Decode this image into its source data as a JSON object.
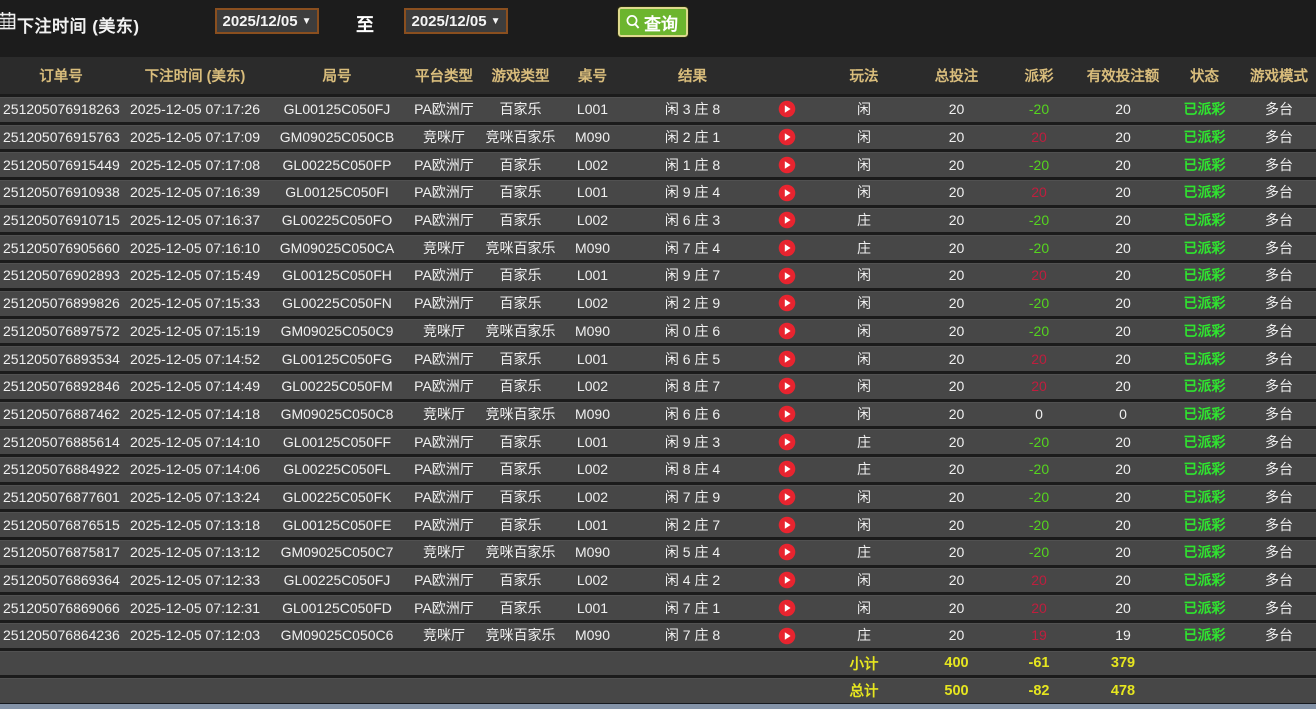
{
  "toolbar": {
    "label": "下注时间 (美东)",
    "date_from": "2025/12/05",
    "date_to": "2025/12/05",
    "to_label": "至",
    "search_label": "查询"
  },
  "colors": {
    "header_text": "#d9bd7c",
    "gain": "#bf1e3e",
    "loss": "#55d41f",
    "status_paid": "#2fe42f",
    "summary": "#e6e61f",
    "button_green": "#6cb52e"
  },
  "table": {
    "columns": [
      "订单号",
      "下注时间 (美东)",
      "局号",
      "平台类型",
      "游戏类型",
      "桌号",
      "结果",
      "",
      "玩法",
      "总投注",
      "派彩",
      "有效投注额",
      "状态",
      "游戏模式"
    ],
    "rows": [
      {
        "order": "251205076918263",
        "time": "2025-12-05 07:17:26",
        "round": "GL00125C050FJ",
        "platform": "PA欧洲厅",
        "game": "百家乐",
        "table_no": "L001",
        "result": "闲 3 庄 8",
        "play": "闲",
        "bet": "20",
        "payout": "-20",
        "payout_tone": "loss",
        "valid": "20",
        "status": "已派彩",
        "mode": "多台"
      },
      {
        "order": "251205076915763",
        "time": "2025-12-05 07:17:09",
        "round": "GM09025C050CB",
        "platform": "竞咪厅",
        "game": "竞咪百家乐",
        "table_no": "M090",
        "result": "闲 2 庄 1",
        "play": "闲",
        "bet": "20",
        "payout": "20",
        "payout_tone": "gain",
        "valid": "20",
        "status": "已派彩",
        "mode": "多台"
      },
      {
        "order": "251205076915449",
        "time": "2025-12-05 07:17:08",
        "round": "GL00225C050FP",
        "platform": "PA欧洲厅",
        "game": "百家乐",
        "table_no": "L002",
        "result": "闲 1 庄 8",
        "play": "闲",
        "bet": "20",
        "payout": "-20",
        "payout_tone": "loss",
        "valid": "20",
        "status": "已派彩",
        "mode": "多台"
      },
      {
        "order": "251205076910938",
        "time": "2025-12-05 07:16:39",
        "round": "GL00125C050FI",
        "platform": "PA欧洲厅",
        "game": "百家乐",
        "table_no": "L001",
        "result": "闲 9 庄 4",
        "play": "闲",
        "bet": "20",
        "payout": "20",
        "payout_tone": "gain",
        "valid": "20",
        "status": "已派彩",
        "mode": "多台"
      },
      {
        "order": "251205076910715",
        "time": "2025-12-05 07:16:37",
        "round": "GL00225C050FO",
        "platform": "PA欧洲厅",
        "game": "百家乐",
        "table_no": "L002",
        "result": "闲 6 庄 3",
        "play": "庄",
        "bet": "20",
        "payout": "-20",
        "payout_tone": "loss",
        "valid": "20",
        "status": "已派彩",
        "mode": "多台"
      },
      {
        "order": "251205076905660",
        "time": "2025-12-05 07:16:10",
        "round": "GM09025C050CA",
        "platform": "竞咪厅",
        "game": "竞咪百家乐",
        "table_no": "M090",
        "result": "闲 7 庄 4",
        "play": "庄",
        "bet": "20",
        "payout": "-20",
        "payout_tone": "loss",
        "valid": "20",
        "status": "已派彩",
        "mode": "多台"
      },
      {
        "order": "251205076902893",
        "time": "2025-12-05 07:15:49",
        "round": "GL00125C050FH",
        "platform": "PA欧洲厅",
        "game": "百家乐",
        "table_no": "L001",
        "result": "闲 9 庄 7",
        "play": "闲",
        "bet": "20",
        "payout": "20",
        "payout_tone": "gain",
        "valid": "20",
        "status": "已派彩",
        "mode": "多台"
      },
      {
        "order": "251205076899826",
        "time": "2025-12-05 07:15:33",
        "round": "GL00225C050FN",
        "platform": "PA欧洲厅",
        "game": "百家乐",
        "table_no": "L002",
        "result": "闲 2 庄 9",
        "play": "闲",
        "bet": "20",
        "payout": "-20",
        "payout_tone": "loss",
        "valid": "20",
        "status": "已派彩",
        "mode": "多台"
      },
      {
        "order": "251205076897572",
        "time": "2025-12-05 07:15:19",
        "round": "GM09025C050C9",
        "platform": "竞咪厅",
        "game": "竞咪百家乐",
        "table_no": "M090",
        "result": "闲 0 庄 6",
        "play": "闲",
        "bet": "20",
        "payout": "-20",
        "payout_tone": "loss",
        "valid": "20",
        "status": "已派彩",
        "mode": "多台"
      },
      {
        "order": "251205076893534",
        "time": "2025-12-05 07:14:52",
        "round": "GL00125C050FG",
        "platform": "PA欧洲厅",
        "game": "百家乐",
        "table_no": "L001",
        "result": "闲 6 庄 5",
        "play": "闲",
        "bet": "20",
        "payout": "20",
        "payout_tone": "gain",
        "valid": "20",
        "status": "已派彩",
        "mode": "多台"
      },
      {
        "order": "251205076892846",
        "time": "2025-12-05 07:14:49",
        "round": "GL00225C050FM",
        "platform": "PA欧洲厅",
        "game": "百家乐",
        "table_no": "L002",
        "result": "闲 8 庄 7",
        "play": "闲",
        "bet": "20",
        "payout": "20",
        "payout_tone": "gain",
        "valid": "20",
        "status": "已派彩",
        "mode": "多台"
      },
      {
        "order": "251205076887462",
        "time": "2025-12-05 07:14:18",
        "round": "GM09025C050C8",
        "platform": "竞咪厅",
        "game": "竞咪百家乐",
        "table_no": "M090",
        "result": "闲 6 庄 6",
        "play": "闲",
        "bet": "20",
        "payout": "0",
        "payout_tone": "zero",
        "valid": "0",
        "status": "已派彩",
        "mode": "多台"
      },
      {
        "order": "251205076885614",
        "time": "2025-12-05 07:14:10",
        "round": "GL00125C050FF",
        "platform": "PA欧洲厅",
        "game": "百家乐",
        "table_no": "L001",
        "result": "闲 9 庄 3",
        "play": "庄",
        "bet": "20",
        "payout": "-20",
        "payout_tone": "loss",
        "valid": "20",
        "status": "已派彩",
        "mode": "多台"
      },
      {
        "order": "251205076884922",
        "time": "2025-12-05 07:14:06",
        "round": "GL00225C050FL",
        "platform": "PA欧洲厅",
        "game": "百家乐",
        "table_no": "L002",
        "result": "闲 8 庄 4",
        "play": "庄",
        "bet": "20",
        "payout": "-20",
        "payout_tone": "loss",
        "valid": "20",
        "status": "已派彩",
        "mode": "多台"
      },
      {
        "order": "251205076877601",
        "time": "2025-12-05 07:13:24",
        "round": "GL00225C050FK",
        "platform": "PA欧洲厅",
        "game": "百家乐",
        "table_no": "L002",
        "result": "闲 7 庄 9",
        "play": "闲",
        "bet": "20",
        "payout": "-20",
        "payout_tone": "loss",
        "valid": "20",
        "status": "已派彩",
        "mode": "多台"
      },
      {
        "order": "251205076876515",
        "time": "2025-12-05 07:13:18",
        "round": "GL00125C050FE",
        "platform": "PA欧洲厅",
        "game": "百家乐",
        "table_no": "L001",
        "result": "闲 2 庄 7",
        "play": "闲",
        "bet": "20",
        "payout": "-20",
        "payout_tone": "loss",
        "valid": "20",
        "status": "已派彩",
        "mode": "多台"
      },
      {
        "order": "251205076875817",
        "time": "2025-12-05 07:13:12",
        "round": "GM09025C050C7",
        "platform": "竞咪厅",
        "game": "竞咪百家乐",
        "table_no": "M090",
        "result": "闲 5 庄 4",
        "play": "庄",
        "bet": "20",
        "payout": "-20",
        "payout_tone": "loss",
        "valid": "20",
        "status": "已派彩",
        "mode": "多台"
      },
      {
        "order": "251205076869364",
        "time": "2025-12-05 07:12:33",
        "round": "GL00225C050FJ",
        "platform": "PA欧洲厅",
        "game": "百家乐",
        "table_no": "L002",
        "result": "闲 4 庄 2",
        "play": "闲",
        "bet": "20",
        "payout": "20",
        "payout_tone": "gain",
        "valid": "20",
        "status": "已派彩",
        "mode": "多台"
      },
      {
        "order": "251205076869066",
        "time": "2025-12-05 07:12:31",
        "round": "GL00125C050FD",
        "platform": "PA欧洲厅",
        "game": "百家乐",
        "table_no": "L001",
        "result": "闲 7 庄 1",
        "play": "闲",
        "bet": "20",
        "payout": "20",
        "payout_tone": "gain",
        "valid": "20",
        "status": "已派彩",
        "mode": "多台"
      },
      {
        "order": "251205076864236",
        "time": "2025-12-05 07:12:03",
        "round": "GM09025C050C6",
        "platform": "竞咪厅",
        "game": "竞咪百家乐",
        "table_no": "M090",
        "result": "闲 7 庄 8",
        "play": "庄",
        "bet": "20",
        "payout": "19",
        "payout_tone": "gain",
        "valid": "19",
        "status": "已派彩",
        "mode": "多台"
      }
    ],
    "subtotal": {
      "label": "小计",
      "bet": "400",
      "payout": "-61",
      "valid": "379"
    },
    "total": {
      "label": "总计",
      "bet": "500",
      "payout": "-82",
      "valid": "478"
    }
  }
}
